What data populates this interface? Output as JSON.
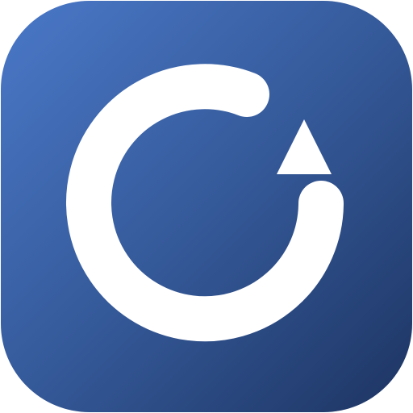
{
  "icon": {
    "name": "refresh-icon",
    "background_gradient": {
      "start": "#4a78c8",
      "mid": "#355a9a",
      "end": "#1d3462"
    },
    "glyph_color": "#ffffff"
  }
}
